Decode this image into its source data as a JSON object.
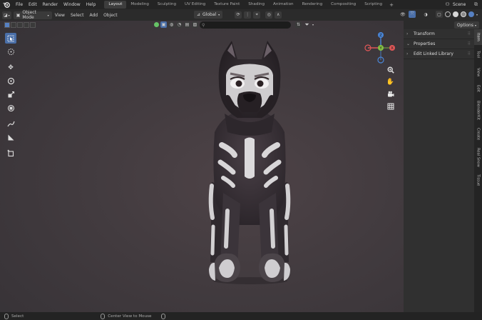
{
  "menu": {
    "items": [
      "File",
      "Edit",
      "Render",
      "Window",
      "Help"
    ]
  },
  "workspaces": {
    "active": 0,
    "tabs": [
      "Layout",
      "Modeling",
      "Sculpting",
      "UV Editing",
      "Texture Paint",
      "Shading",
      "Animation",
      "Rendering",
      "Compositing",
      "Scripting"
    ],
    "add_label": "+"
  },
  "scene": {
    "label": "Scene"
  },
  "header": {
    "editor_icon": "cube-icon",
    "mode_label": "Object Mode",
    "menus": [
      "View",
      "Select",
      "Add",
      "Object"
    ],
    "transform_orientation": "Global"
  },
  "search": {
    "placeholder": ""
  },
  "options": {
    "label": "Options"
  },
  "npanel": {
    "sections": [
      {
        "label": "Transform",
        "expanded": false
      },
      {
        "label": "Properties",
        "expanded": true
      },
      {
        "label": "Edit Linked Library",
        "expanded": false
      }
    ],
    "tabs": [
      "Item",
      "Tool",
      "View",
      "Edit",
      "BlenderKit",
      "Create",
      "Real Snow",
      "Tissue"
    ],
    "active_tab": 0
  },
  "statusbar": {
    "select_label": "Select",
    "center_label": "Center View to Mouse"
  },
  "gizmo": {
    "x_label": "X",
    "y_label": "Y",
    "z_label": "Z"
  },
  "colors": {
    "accent_blue": "#4a6fa8",
    "axis_x": "#e05757",
    "axis_y": "#84c043",
    "axis_z": "#4a86d8"
  }
}
